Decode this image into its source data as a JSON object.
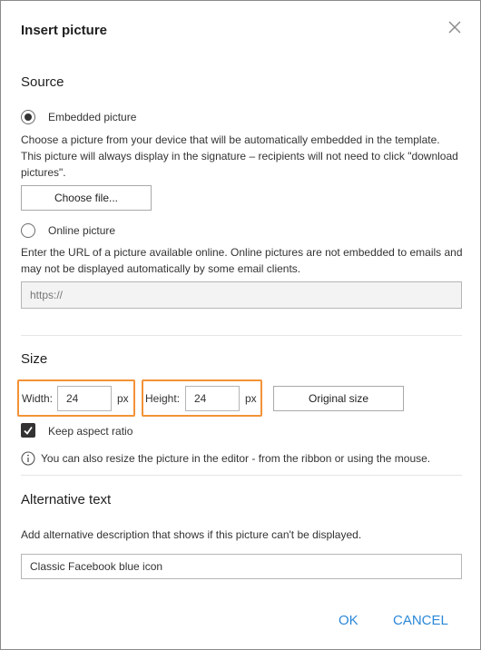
{
  "dialog": {
    "title": "Insert picture",
    "close_icon": "close-icon"
  },
  "source": {
    "heading": "Source",
    "embedded": {
      "label": "Embedded picture",
      "checked": true,
      "description_line1": "Choose a picture from your device that will be automatically embedded in the template.",
      "description_line2": "This picture will always display in the signature – recipients will not need to click \"download",
      "description_line3": "pictures\".",
      "choose_file_label": "Choose file..."
    },
    "online": {
      "label": "Online picture",
      "checked": false,
      "description_line1": "Enter the URL of a picture available online. Online pictures are not embedded to emails and",
      "description_line2": "may not be displayed automatically by some email clients.",
      "url_placeholder": "https://"
    }
  },
  "size": {
    "heading": "Size",
    "width_label": "Width:",
    "width_value": "24",
    "width_unit": "px",
    "height_label": "Height:",
    "height_value": "24",
    "height_unit": "px",
    "original_size_label": "Original size",
    "keep_aspect_label": "Keep aspect ratio",
    "keep_aspect_checked": true,
    "info_text": "You can also resize the picture in the editor - from the ribbon or using the mouse."
  },
  "alt_text": {
    "heading": "Alternative text",
    "description": "Add alternative description that shows if this picture can't be displayed.",
    "value": "Classic Facebook blue icon"
  },
  "footer": {
    "ok_label": "OK",
    "cancel_label": "CANCEL"
  },
  "colors": {
    "accent": "#2b88d8",
    "highlight": "#f39237"
  }
}
